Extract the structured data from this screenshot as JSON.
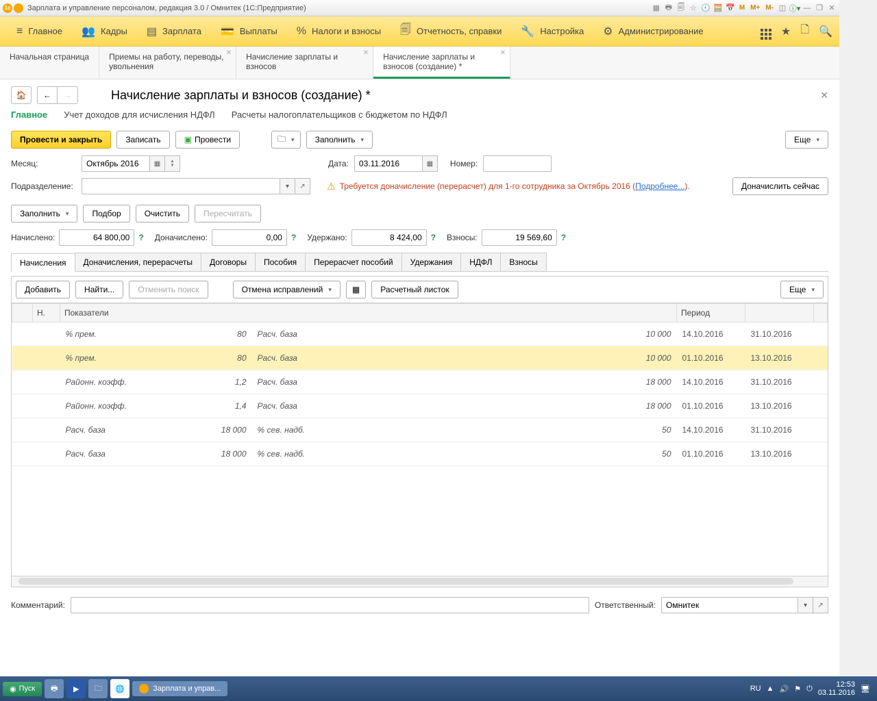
{
  "titlebar": {
    "text": "Зарплата и управление персоналом, редакция 3.0 / Омнитек  (1С:Предприятие)",
    "m_buttons": [
      "M",
      "M+",
      "M-"
    ]
  },
  "main_menu": [
    {
      "icon": "≡",
      "label": "Главное"
    },
    {
      "icon": "👥",
      "label": "Кадры"
    },
    {
      "icon": "▤",
      "label": "Зарплата"
    },
    {
      "icon": "💳",
      "label": "Выплаты"
    },
    {
      "icon": "%",
      "label": "Налоги и взносы"
    },
    {
      "icon": "🗐",
      "label": "Отчетность, справки"
    },
    {
      "icon": "🔧",
      "label": "Настройка"
    },
    {
      "icon": "⚙",
      "label": "Администрирование"
    }
  ],
  "doc_tabs": [
    {
      "label": "Начальная страница",
      "closable": false
    },
    {
      "label": "Приемы на работу, переводы, увольнения",
      "closable": true
    },
    {
      "label": "Начисление зарплаты и взносов",
      "closable": true
    },
    {
      "label": "Начисление зарплаты и взносов (создание) *",
      "closable": true,
      "active": true
    }
  ],
  "page": {
    "title": "Начисление зарплаты и взносов (создание) *",
    "sub_nav": [
      {
        "label": "Главное",
        "active": true
      },
      {
        "label": "Учет доходов для исчисления НДФЛ"
      },
      {
        "label": "Расчеты налогоплательщиков с бюджетом по НДФЛ"
      }
    ]
  },
  "actions": {
    "post_close": "Провести и закрыть",
    "save": "Записать",
    "post": "Провести",
    "fill": "Заполнить",
    "more": "Еще"
  },
  "fields": {
    "month_label": "Месяц:",
    "month_value": "Октябрь 2016",
    "date_label": "Дата:",
    "date_value": "03.11.2016",
    "number_label": "Номер:",
    "number_value": "",
    "division_label": "Подразделение:",
    "division_value": ""
  },
  "warning": {
    "text": "Требуется доначисление (перерасчет) для 1-го сотрудника за Октябрь 2016 (",
    "link": "Подробнее...",
    "tail": ").",
    "button": "Доначислить сейчас"
  },
  "mid_buttons": {
    "fill": "Заполнить",
    "pick": "Подбор",
    "clear": "Очистить",
    "recalc": "Пересчитать"
  },
  "totals": {
    "accrued_label": "Начислено:",
    "accrued": "64 800,00",
    "additional_label": "Доначислено:",
    "additional": "0,00",
    "withheld_label": "Удержано:",
    "withheld": "8 424,00",
    "contrib_label": "Взносы:",
    "contrib": "19 569,60"
  },
  "inner_tabs": [
    "Начисления",
    "Доначисления, перерасчеты",
    "Договоры",
    "Пособия",
    "Перерасчет пособий",
    "Удержания",
    "НДФЛ",
    "Взносы"
  ],
  "tbl_toolbar": {
    "add": "Добавить",
    "find": "Найти...",
    "cancel_search": "Отменить поиск",
    "cancel_fix": "Отмена исправлений",
    "payslip": "Расчетный листок",
    "more": "Еще"
  },
  "table": {
    "headers": {
      "n": "Н.",
      "indicators": "Показатели",
      "period": "Период"
    },
    "rows": [
      {
        "c1": "% прем.",
        "v1": "80",
        "c2": "Расч. база",
        "v2": "10 000",
        "d1": "14.10.2016",
        "d2": "31.10.2016",
        "hl": false
      },
      {
        "c1": "% прем.",
        "v1": "80",
        "c2": "Расч. база",
        "v2": "10 000",
        "d1": "01.10.2016",
        "d2": "13.10.2016",
        "hl": true
      },
      {
        "c1": "Районн. коэфф.",
        "v1": "1,2",
        "c2": "Расч. база",
        "v2": "18 000",
        "d1": "14.10.2016",
        "d2": "31.10.2016",
        "hl": false
      },
      {
        "c1": "Районн. коэфф.",
        "v1": "1,4",
        "c2": "Расч. база",
        "v2": "18 000",
        "d1": "01.10.2016",
        "d2": "13.10.2016",
        "hl": false
      },
      {
        "c1": "Расч. база",
        "v1": "18 000",
        "c2": "% сев. надб.",
        "v2": "50",
        "d1": "14.10.2016",
        "d2": "31.10.2016",
        "hl": false
      },
      {
        "c1": "Расч. база",
        "v1": "18 000",
        "c2": "% сев. надб.",
        "v2": "50",
        "d1": "01.10.2016",
        "d2": "13.10.2016",
        "hl": false
      }
    ]
  },
  "footer": {
    "comment_label": "Комментарий:",
    "comment_value": "",
    "responsible_label": "Ответственный:",
    "responsible_value": "Омнитек"
  },
  "taskbar": {
    "start": "Пуск",
    "task": "Зарплата и управ...",
    "lang": "RU",
    "time": "12:53",
    "date": "03.11.2016"
  }
}
